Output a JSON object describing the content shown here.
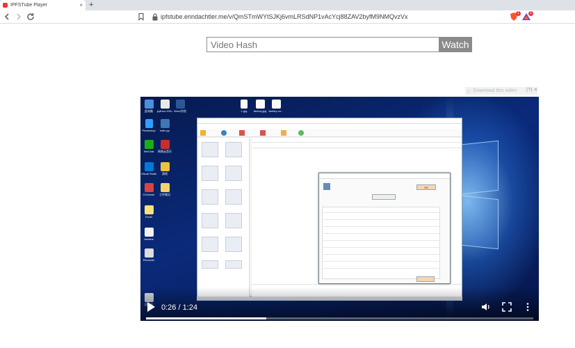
{
  "browser": {
    "tab_title": "IPFSTube Player",
    "tab_close": "×",
    "new_tab": "+",
    "url": "ipfstube.erindachtler.me/v/QmSTmWYtSJKj6vmLRSdNP1vAcYcj88ZAV2byfM9NMQvzVx",
    "back_icon": "back-arrow-icon",
    "forward_icon": "forward-arrow-icon",
    "reload_icon": "reload-icon",
    "bookmark_icon": "bookmark-icon",
    "lock_icon": "lock-icon",
    "extension_icons": [
      "brave-shield-icon",
      "brave-rewards-icon"
    ],
    "accent_color": "#e53935"
  },
  "search": {
    "placeholder": "Video Hash",
    "value": "",
    "button_label": "Watch"
  },
  "download": {
    "label": "Download this video",
    "extra": "(?) ✕"
  },
  "player": {
    "current_time": "0:26",
    "duration": "1:24",
    "time_display": "0:26 / 1:24",
    "progress_fraction": 0.31,
    "controls": [
      "play-icon",
      "volume-icon",
      "fullscreen-icon",
      "more-options-icon"
    ]
  },
  "video_frame": {
    "desktop_icons": [
      "此电脑",
      "python-100-days",
      "Word文档",
      "回收站",
      "Photoshop",
      "hello.py",
      "WeChat",
      "网易云音乐",
      "Visual Studio Code",
      "游戏",
      "CCleaner",
      "工作笔记",
      "Excel",
      "viewers",
      "Recorder"
    ],
    "top_files": [
      "1.jpg",
      "factory.jpg",
      "factory-co..."
    ]
  }
}
